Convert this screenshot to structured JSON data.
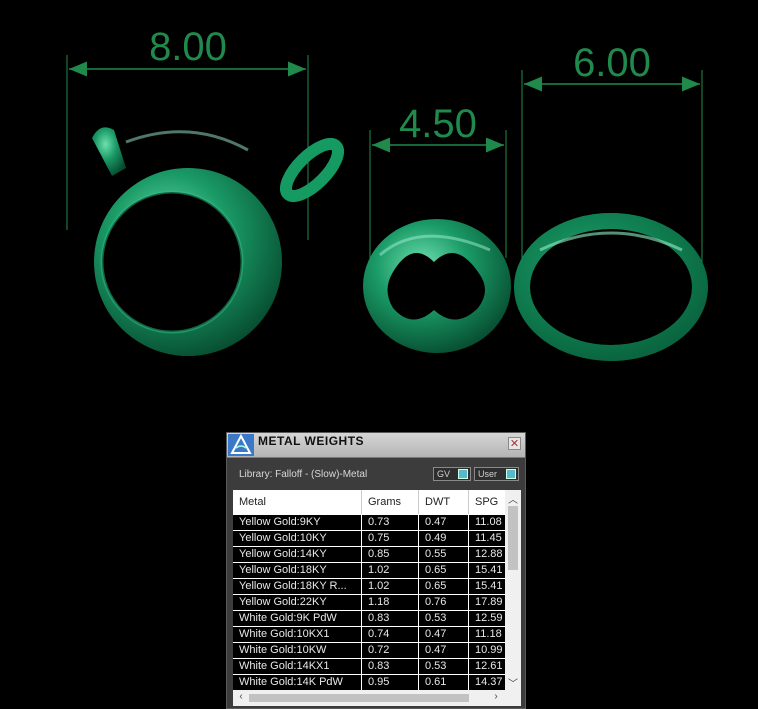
{
  "dimensions": {
    "clasp_width": "8.00",
    "small_ring_width": "4.50",
    "oval_ring_width": "6.00"
  },
  "colors": {
    "dimension_line": "#1f8a4c",
    "metal_green": "#1aa06a",
    "background": "#000000"
  },
  "panel": {
    "title": "METAL WEIGHTS",
    "close_icon": "close-icon",
    "library_label": "Library: Falloff - (Slow)-Metal",
    "gv_toggle": "GV",
    "user_toggle": "User",
    "columns": [
      "Metal",
      "Grams",
      "DWT",
      "SPG"
    ],
    "rows": [
      {
        "metal": "Yellow Gold:9KY",
        "grams": "0.73",
        "dwt": "0.47",
        "spg": "11.08"
      },
      {
        "metal": "Yellow Gold:10KY",
        "grams": "0.75",
        "dwt": "0.49",
        "spg": "11.45"
      },
      {
        "metal": "Yellow Gold:14KY",
        "grams": "0.85",
        "dwt": "0.55",
        "spg": "12.88"
      },
      {
        "metal": "Yellow Gold:18KY",
        "grams": "1.02",
        "dwt": "0.65",
        "spg": "15.41"
      },
      {
        "metal": "Yellow Gold:18KY R...",
        "grams": "1.02",
        "dwt": "0.65",
        "spg": "15.41"
      },
      {
        "metal": "Yellow Gold:22KY",
        "grams": "1.18",
        "dwt": "0.76",
        "spg": "17.89"
      },
      {
        "metal": "White Gold:9K PdW",
        "grams": "0.83",
        "dwt": "0.53",
        "spg": "12.59"
      },
      {
        "metal": "White Gold:10KX1",
        "grams": "0.74",
        "dwt": "0.47",
        "spg": "11.18"
      },
      {
        "metal": "White Gold:10KW",
        "grams": "0.72",
        "dwt": "0.47",
        "spg": "10.99"
      },
      {
        "metal": "White Gold:14KX1",
        "grams": "0.83",
        "dwt": "0.53",
        "spg": "12.61"
      },
      {
        "metal": "White Gold:14K PdW",
        "grams": "0.95",
        "dwt": "0.61",
        "spg": "14.37"
      }
    ]
  }
}
